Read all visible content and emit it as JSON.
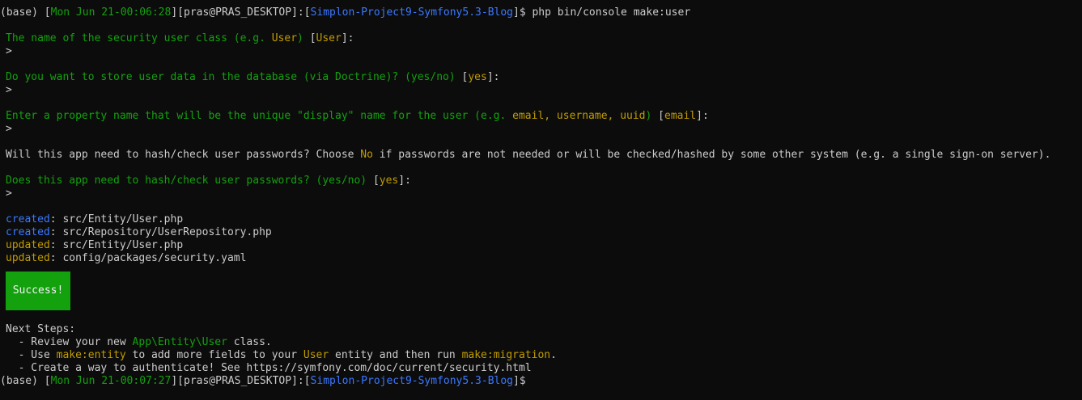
{
  "prompt1": {
    "env": "(base)",
    "datetime": "Mon Jun 21-00:06:28",
    "user_host": "pras@PRAS_DESKTOP",
    "dir": "Simplon-Project9-Symfony5.3-Blog",
    "command": "php bin/console make:user"
  },
  "q1": {
    "text": "The name of the security user class (e.g. ",
    "example": "User",
    "close": ") ",
    "default": "User",
    "end": ":"
  },
  "q2": {
    "text": "Do you want to store user data in the database (via Doctrine)? (yes/no) ",
    "default": "yes",
    "end": ":"
  },
  "q3": {
    "text": "Enter a property name that will be the unique \"display\" name for the user (e.g. ",
    "example": "email, username, uuid",
    "close": ") ",
    "default": "email",
    "end": ":"
  },
  "info": {
    "before": "Will this app need to hash/check user passwords? Choose ",
    "no": "No",
    "after": " if passwords are not needed or will be checked/hashed by some other system (e.g. a single sign-on server)."
  },
  "q4": {
    "text": "Does this app need to hash/check user passwords? (yes/no) ",
    "default": "yes",
    "end": ":"
  },
  "input_prompt": ">",
  "files": [
    {
      "status": "created",
      "path": ": src/Entity/User.php"
    },
    {
      "status": "created",
      "path": ": src/Repository/UserRepository.php"
    },
    {
      "status": "updated",
      "path": ": src/Entity/User.php"
    },
    {
      "status": "updated",
      "path": ": config/packages/security.yaml"
    }
  ],
  "success": "Success!",
  "next_steps": {
    "title": "Next Steps:",
    "step1_a": "  - Review your new ",
    "step1_b": "App\\Entity\\User",
    "step1_c": " class.",
    "step2_a": "  - Use ",
    "step2_b": "make:entity",
    "step2_c": " to add more fields to your ",
    "step2_d": "User",
    "step2_e": " entity and then run ",
    "step2_f": "make:migration",
    "step2_g": ".",
    "step3": "  - Create a way to authenticate! See https://symfony.com/doc/current/security.html"
  },
  "prompt2": {
    "env": "(base)",
    "datetime": "Mon Jun 21-00:07:27",
    "user_host": "pras@PRAS_DESKTOP",
    "dir": "Simplon-Project9-Symfony5.3-Blog"
  },
  "colors": {
    "background": "#0c0c0c",
    "foreground": "#cccccc",
    "green": "#13a10e",
    "yellow": "#c19c00",
    "blue": "#3b78ff"
  }
}
